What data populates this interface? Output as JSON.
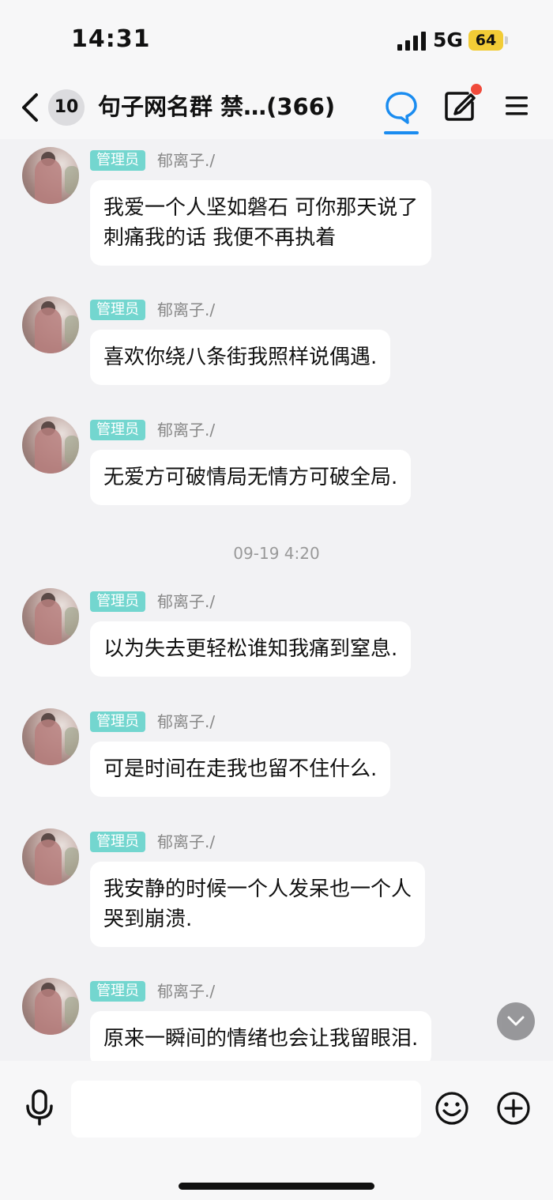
{
  "status_bar": {
    "time": "14:31",
    "network": "5G",
    "battery": "64",
    "battery_color": "#f2cc36"
  },
  "nav": {
    "unread_count": "10",
    "title": "句子网名群 禁…(366)",
    "accent_color": "#1a8cf0",
    "icons": [
      "back-icon",
      "chat-bubble-icon",
      "edit-icon",
      "menu-icon"
    ]
  },
  "messages": [
    {
      "role": "管理员",
      "sender": "郁离子./",
      "lines": [
        "我爱一个人坚如磐石 可你那天说了",
        "刺痛我的话 我便不再执着"
      ]
    },
    {
      "role": "管理员",
      "sender": "郁离子./",
      "lines": [
        "喜欢你绕八条街我照样说偶遇."
      ]
    },
    {
      "role": "管理员",
      "sender": "郁离子./",
      "lines": [
        "无爱方可破情局无情方可破全局."
      ]
    },
    {
      "role": "管理员",
      "sender": "郁离子./",
      "lines": [
        "以为失去更轻松谁知我痛到窒息."
      ]
    },
    {
      "role": "管理员",
      "sender": "郁离子./",
      "lines": [
        "可是时间在走我也留不住什么."
      ]
    },
    {
      "role": "管理员",
      "sender": "郁离子./",
      "lines": [
        "我安静的时候一个人发呆也一个人",
        "哭到崩溃."
      ]
    },
    {
      "role": "管理员",
      "sender": "郁离子./",
      "lines": [
        "原来一瞬间的情绪也会让我留眼泪."
      ]
    }
  ],
  "timestamp": "09-19 4:20",
  "input": {
    "value": "",
    "icons": [
      "mic-icon",
      "emoji-icon",
      "plus-icon"
    ]
  }
}
